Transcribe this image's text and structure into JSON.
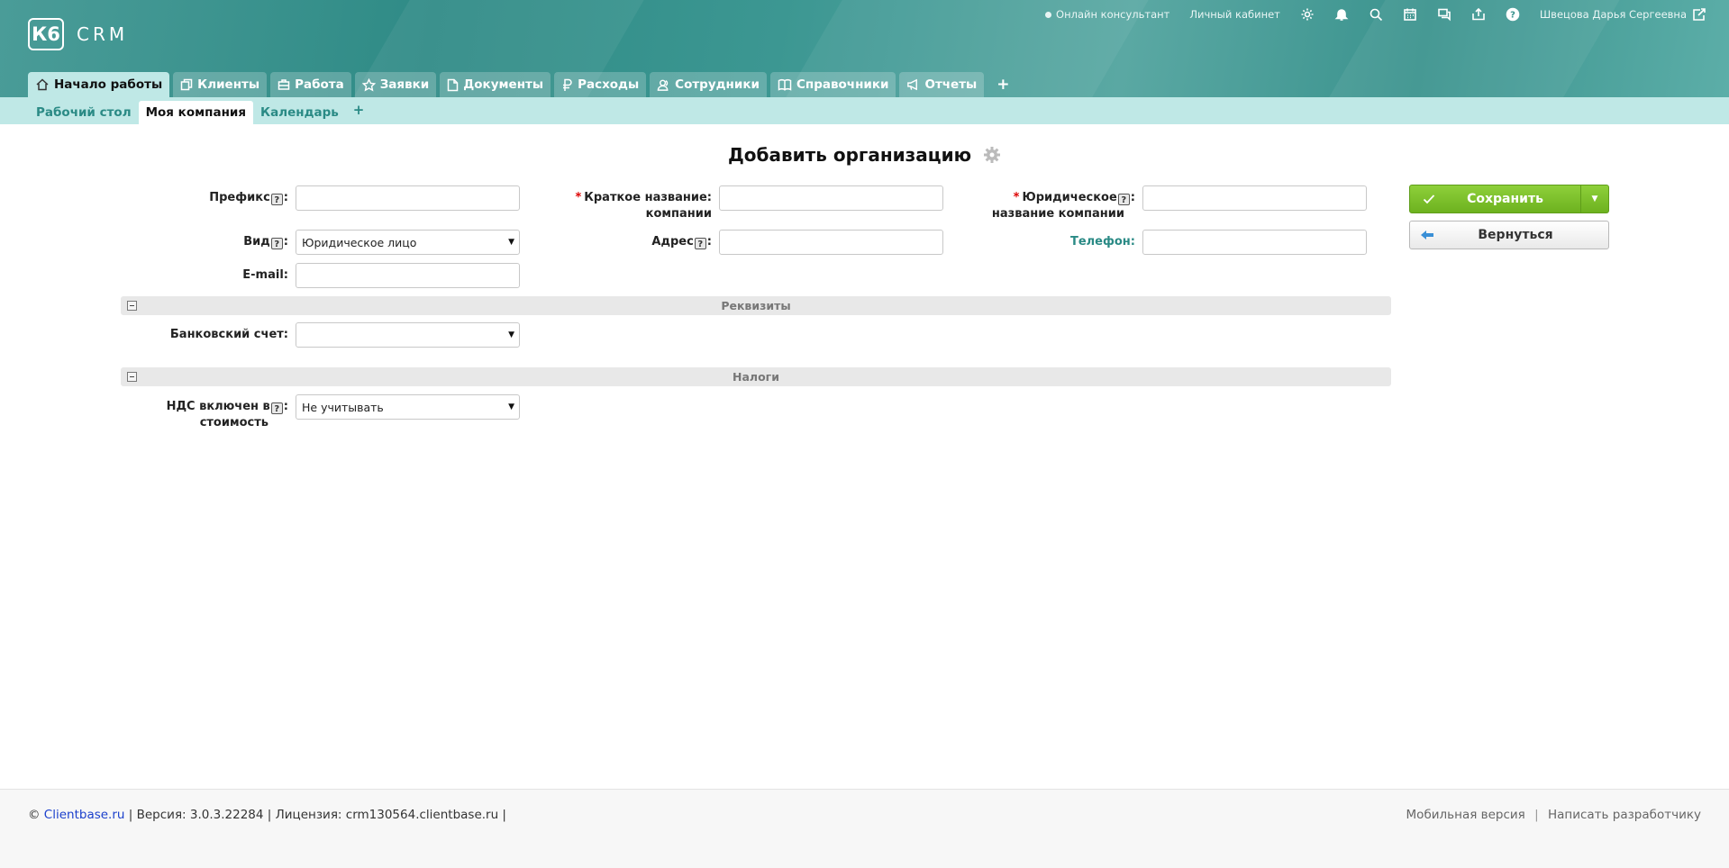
{
  "app": {
    "logo_mark": "К6",
    "logo_text": "CRM"
  },
  "topbar": {
    "online_consultant": "Онлайн консультант",
    "personal_cabinet": "Личный кабинет",
    "icons": [
      "gear-icon",
      "bell-icon",
      "search-icon",
      "calendar-icon",
      "chat-icon",
      "share-icon",
      "help-icon"
    ],
    "user_name": "Швецова Дарья Сергеевна"
  },
  "tabs": [
    {
      "label": "Начало работы",
      "icon": "home-icon",
      "active": true
    },
    {
      "label": "Клиенты",
      "icon": "copy-icon"
    },
    {
      "label": "Работа",
      "icon": "briefcase-icon"
    },
    {
      "label": "Заявки",
      "icon": "star-icon"
    },
    {
      "label": "Документы",
      "icon": "document-icon"
    },
    {
      "label": "Расходы",
      "icon": "ruble-icon"
    },
    {
      "label": "Сотрудники",
      "icon": "users-icon"
    },
    {
      "label": "Справочники",
      "icon": "book-icon"
    },
    {
      "label": "Отчеты",
      "icon": "megaphone-icon"
    }
  ],
  "tab_add": "+",
  "subtabs": [
    {
      "label": "Рабочий стол"
    },
    {
      "label": "Моя компания",
      "active": true
    },
    {
      "label": "Календарь"
    }
  ],
  "subtab_add": "+",
  "page": {
    "title": "Добавить организацию"
  },
  "form": {
    "prefix_label": "Префикс",
    "prefix_value": "",
    "short_name_label_1": "Краткое название:",
    "short_name_label_2": "компании",
    "short_name_value": "",
    "legal_name_label_1": "Юридическое",
    "legal_name_label_2": "название компании",
    "legal_name_value": "",
    "type_label": "Вид",
    "type_value": "Юридическое лицо",
    "address_label": "Адрес",
    "address_value": "",
    "phone_label": "Телефон:",
    "phone_value": "",
    "email_label": "E-mail:",
    "email_value": "",
    "required_mark": "*",
    "colon": ":",
    "help_mark": "?"
  },
  "sections": {
    "requisites": "Реквизиты",
    "bank_account_label": "Банковский счет:",
    "bank_account_value": "",
    "taxes": "Налоги",
    "vat_label_1": "НДС включен в",
    "vat_label_2": "стоимость",
    "vat_value": "Не учитывать"
  },
  "buttons": {
    "save": "Сохранить",
    "back": "Вернуться"
  },
  "footer": {
    "copyright": "©",
    "site_link": "Clientbase.ru",
    "version": "| Версия: 3.0.3.22284 | Лицензия: crm130564.clientbase.ru |",
    "mobile": "Мобильная версия",
    "separator": "|",
    "write_dev": "Написать разработчику"
  },
  "colors": {
    "header": "#3a938e",
    "accent": "#2a8a85",
    "subnav": "#bfe8e6",
    "save_green": "#7cc22b",
    "required": "#dd0000"
  }
}
